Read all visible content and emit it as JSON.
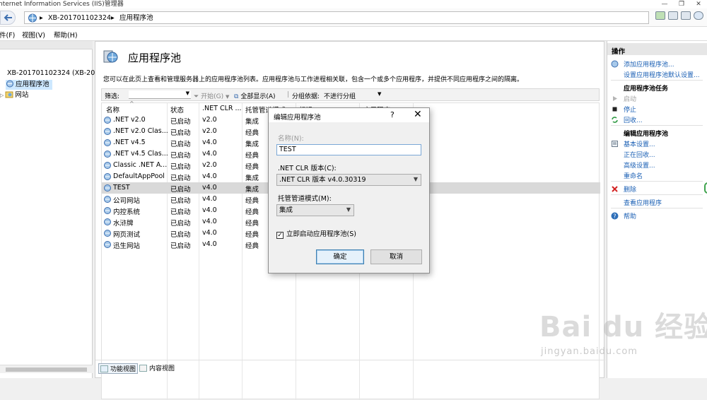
{
  "window": {
    "title": "nternet Information Services (IIS)管理器"
  },
  "address": {
    "crumbs": [
      "XB-201701102324",
      "应用程序池"
    ]
  },
  "menu": {
    "items": [
      "件(F)",
      "视图(V)",
      "帮助(H)"
    ]
  },
  "tree": {
    "server": "XB-201701102324 (XB-201",
    "pools": "应用程序池",
    "sites": "网站"
  },
  "page": {
    "title": "应用程序池",
    "description": "您可以在此页上查看和管理服务器上的应用程序池列表。应用程序池与工作进程相关联，包含一个或多个应用程序，并提供不同应用程序之间的隔离。"
  },
  "filter": {
    "label": "筛选:",
    "go": "开始(G)",
    "show_all": "全部显示(A)",
    "group_by_label": "分组依据:",
    "group_by_value": "不进行分组"
  },
  "grid": {
    "columns": [
      "名称",
      "状态",
      ".NET CLR ...",
      "托管管道模式",
      "标识",
      "应用程序"
    ],
    "rows": [
      {
        "name": ".NET v2.0",
        "status": "已启动",
        "clr": "v2.0",
        "mode": "集成"
      },
      {
        "name": ".NET v2.0 Clas...",
        "status": "已启动",
        "clr": "v2.0",
        "mode": "经典"
      },
      {
        "name": ".NET v4.5",
        "status": "已启动",
        "clr": "v4.0",
        "mode": "集成"
      },
      {
        "name": ".NET v4.5 Clas...",
        "status": "已启动",
        "clr": "v4.0",
        "mode": "经典"
      },
      {
        "name": "Classic .NET A...",
        "status": "已启动",
        "clr": "v2.0",
        "mode": "经典"
      },
      {
        "name": "DefaultAppPool",
        "status": "已启动",
        "clr": "v4.0",
        "mode": "集成"
      },
      {
        "name": "TEST",
        "status": "已启动",
        "clr": "v4.0",
        "mode": "集成"
      },
      {
        "name": "公司网站",
        "status": "已启动",
        "clr": "v4.0",
        "mode": "经典"
      },
      {
        "name": "内控系统",
        "status": "已启动",
        "clr": "v4.0",
        "mode": "经典"
      },
      {
        "name": "水浒牌",
        "status": "已启动",
        "clr": "v4.0",
        "mode": "经典"
      },
      {
        "name": "网页测试",
        "status": "已启动",
        "clr": "v4.0",
        "mode": "经典"
      },
      {
        "name": "迅生网站",
        "status": "已启动",
        "clr": "v4.0",
        "mode": "经典"
      }
    ]
  },
  "views": {
    "features": "功能视图",
    "content": "内容视图"
  },
  "actions": {
    "header": "操作",
    "add_pool": "添加应用程序池...",
    "set_defaults": "设置应用程序池默认设置...",
    "tasks_header": "应用程序池任务",
    "start": "启动",
    "stop": "停止",
    "recycle": "回收...",
    "edit_header": "编辑应用程序池",
    "basic_settings": "基本设置...",
    "recycling": "正在回收...",
    "advanced": "高级设置...",
    "rename": "重命名",
    "remove": "删除",
    "view_apps": "查看应用程序",
    "help": "帮助"
  },
  "dialog": {
    "title": "编辑应用程序池",
    "help_glyph": "?",
    "close_glyph": "✕",
    "name_label": "名称(N):",
    "name_value": "TEST",
    "clr_label": ".NET CLR 版本(C):",
    "clr_value": ".NET CLR 版本 v4.0.30319",
    "mode_label": "托管管道模式(M):",
    "mode_value": "集成",
    "autostart_label": "立即启动应用程序池(S)",
    "autostart_checked": true,
    "ok": "确定",
    "cancel": "取消"
  },
  "watermark": {
    "brand": "Bai du 经验",
    "url": "jingyan.baidu.com"
  },
  "colors": {
    "link": "#1a5fb4",
    "selection": "#d9d9d9",
    "tree_selection": "#cde8ff",
    "ok_border": "#3c7fb1"
  }
}
